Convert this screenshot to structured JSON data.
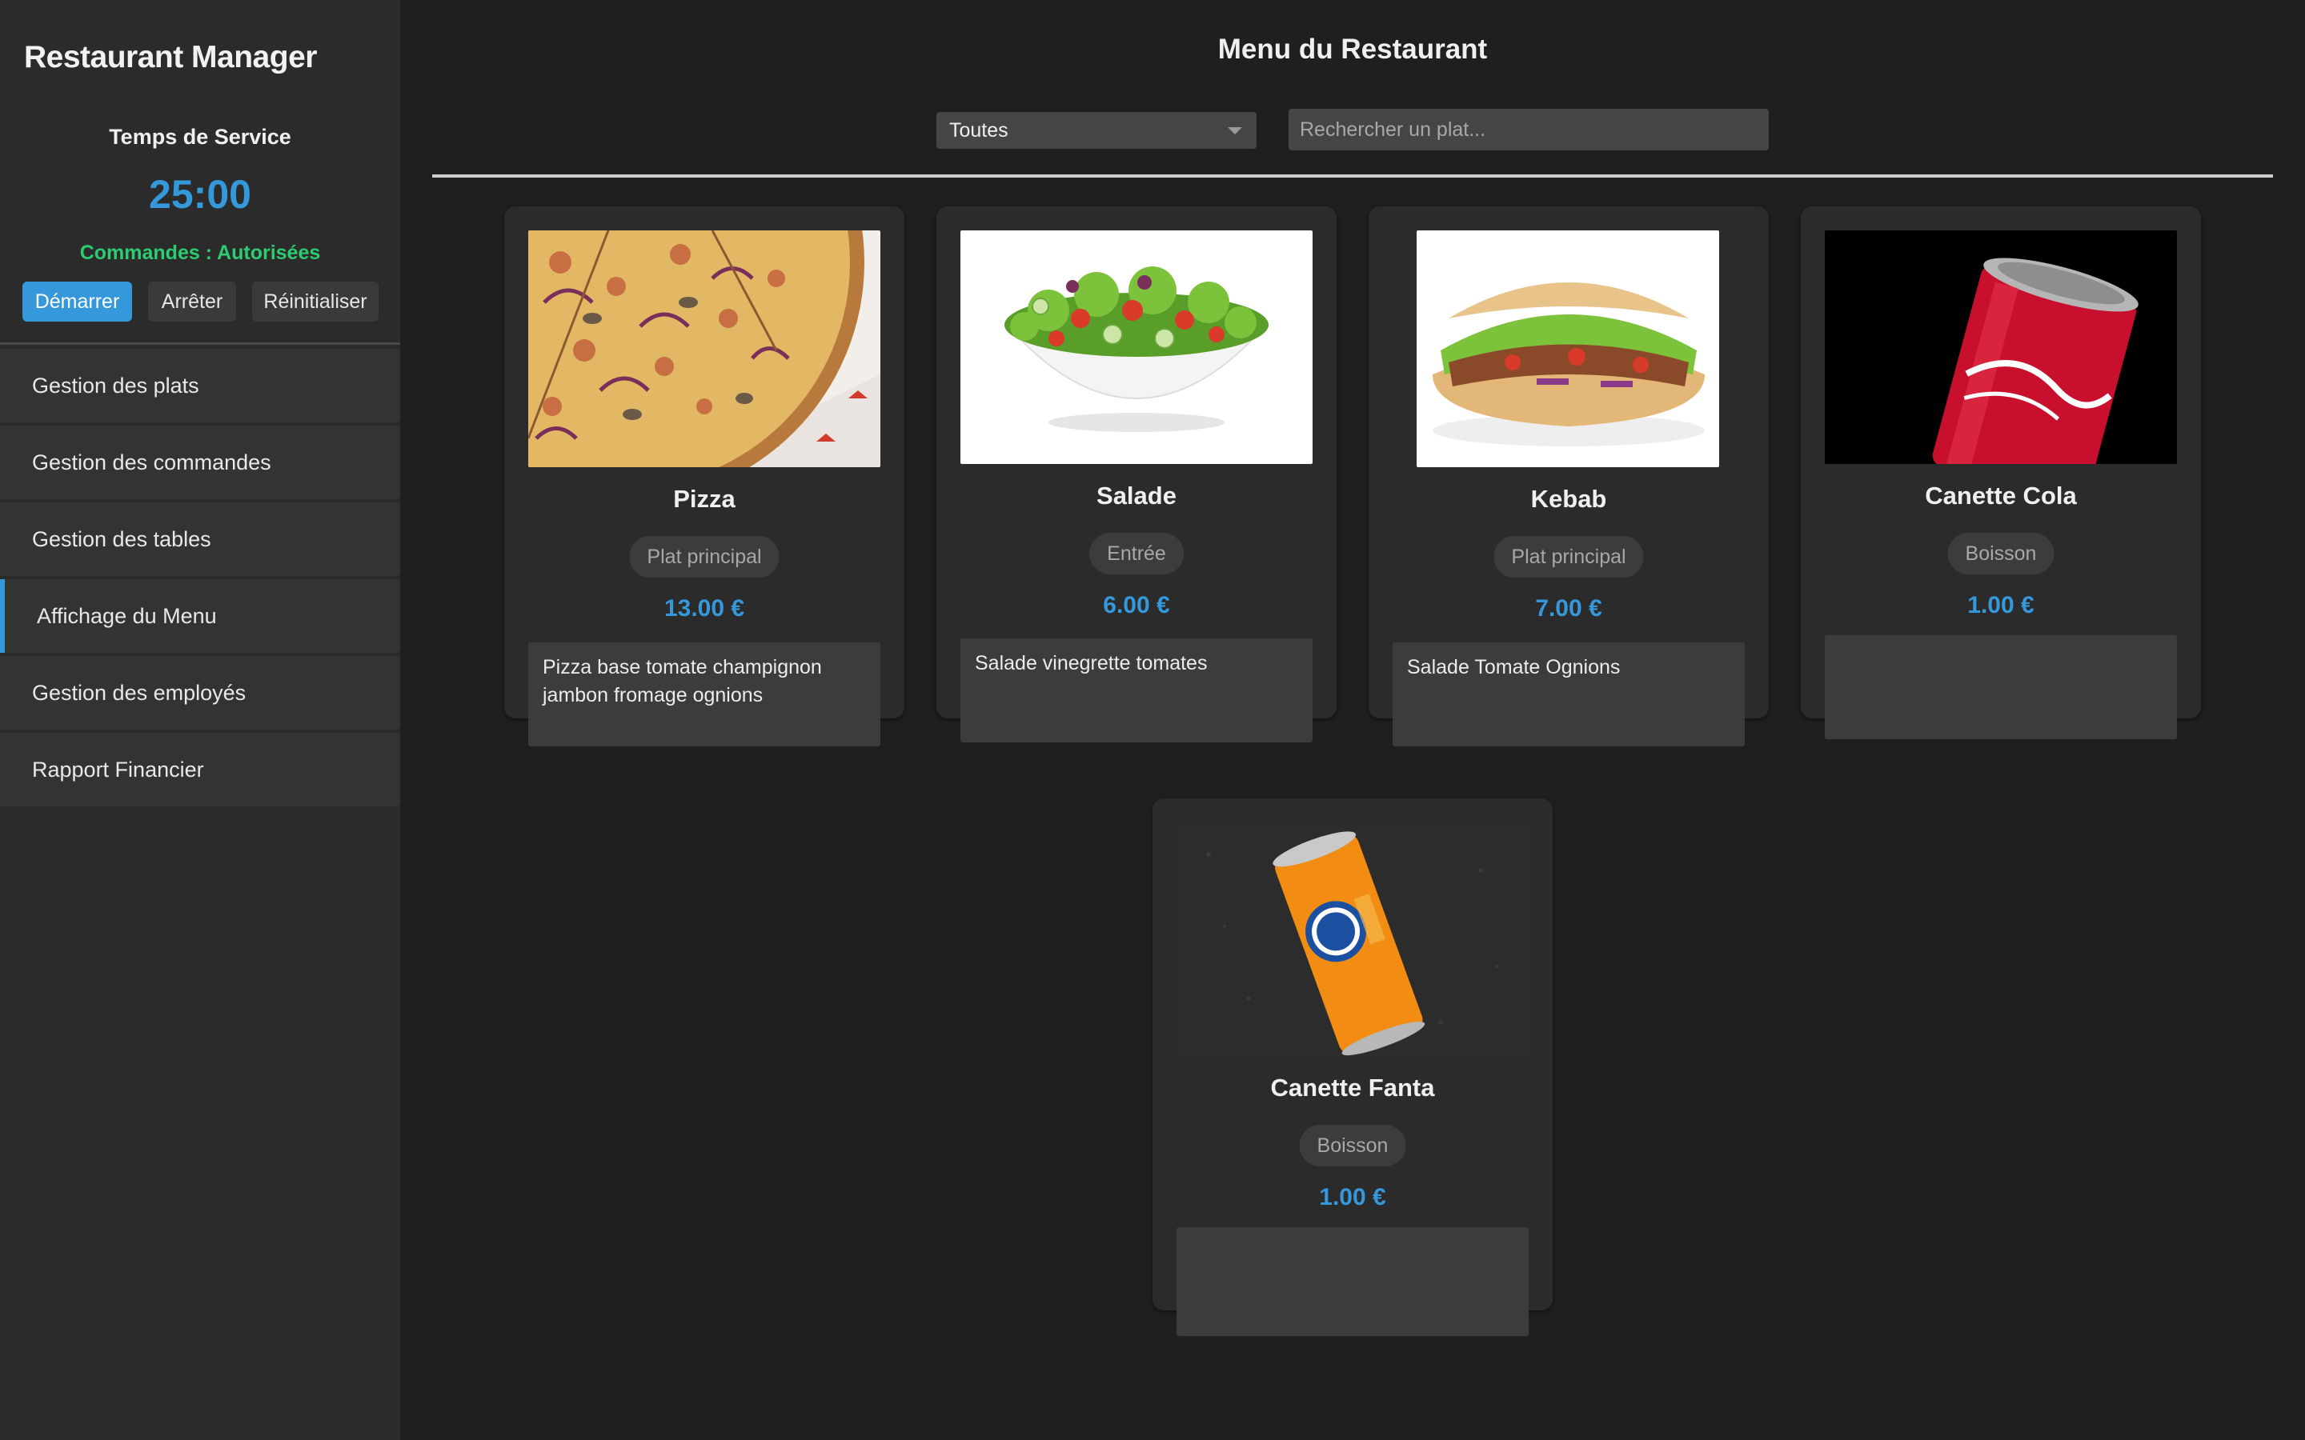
{
  "app": {
    "title": "Restaurant Manager"
  },
  "service": {
    "label": "Temps de Service",
    "timer": "25:00",
    "status": "Commandes : Autorisées",
    "status_color": "#2ecc71",
    "buttons": {
      "start": "Démarrer",
      "stop": "Arrêter",
      "reset": "Réinitialiser"
    }
  },
  "sidebar": {
    "items": [
      {
        "label": "Gestion des plats",
        "active": false
      },
      {
        "label": "Gestion des commandes",
        "active": false
      },
      {
        "label": "Gestion des tables",
        "active": false
      },
      {
        "label": "Affichage du Menu",
        "active": true
      },
      {
        "label": "Gestion des employés",
        "active": false
      },
      {
        "label": "Rapport Financier",
        "active": false
      }
    ]
  },
  "main": {
    "title": "Menu du Restaurant",
    "filter": {
      "selected": "Toutes"
    },
    "search": {
      "placeholder": "Rechercher un plat...",
      "value": ""
    }
  },
  "menu": [
    {
      "name": "Pizza",
      "category": "Plat principal",
      "price": "13.00 €",
      "description": "Pizza base tomate champignon jambon fromage ognions",
      "image": "pizza-image"
    },
    {
      "name": "Salade",
      "category": "Entrée",
      "price": "6.00 €",
      "description": "Salade vinegrette tomates",
      "image": "salad-bowl-image"
    },
    {
      "name": "Kebab",
      "category": "Plat principal",
      "price": "7.00 €",
      "description": "Salade Tomate Ognions",
      "image": "kebab-image"
    },
    {
      "name": "Canette Cola",
      "category": "Boisson",
      "price": "1.00 €",
      "description": "",
      "image": "cola-can-image"
    },
    {
      "name": "Canette Fanta",
      "category": "Boisson",
      "price": "1.00 €",
      "description": "",
      "image": "fanta-can-image"
    }
  ],
  "colors": {
    "accent": "#3498db",
    "success": "#2ecc71",
    "background": "#1f1f1f",
    "sidebar": "#2b2b2b"
  }
}
